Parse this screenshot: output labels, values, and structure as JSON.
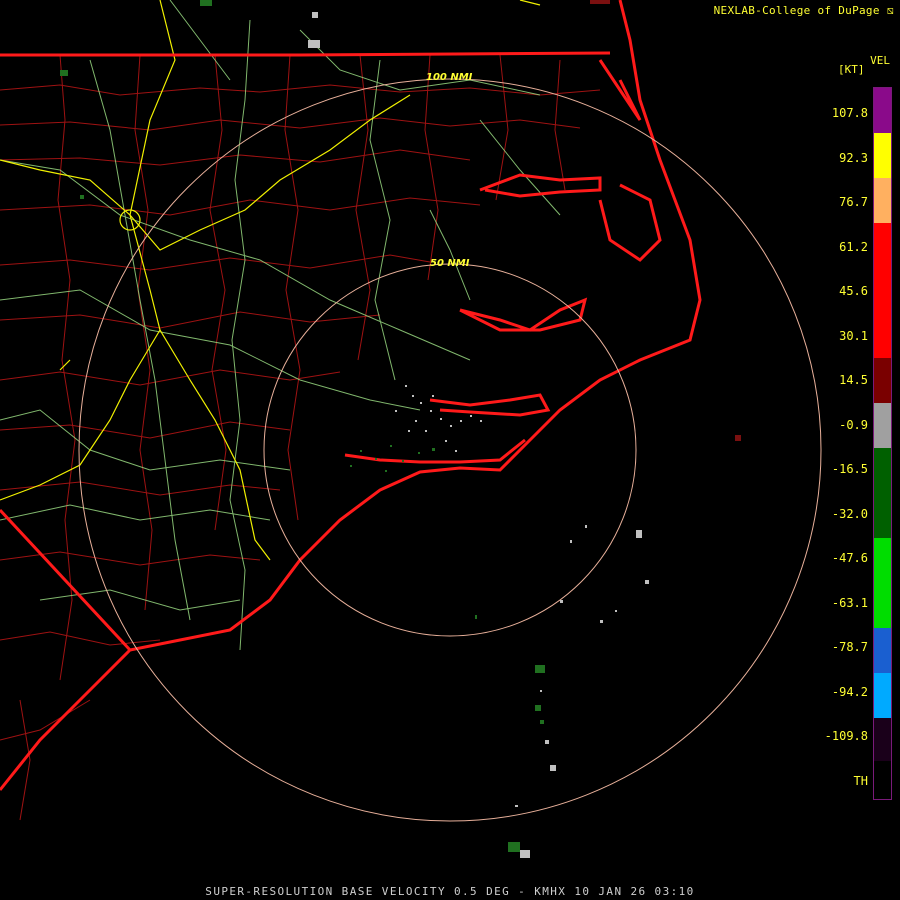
{
  "header": {
    "credit": "NEXLAB-College of DuPage ⧅"
  },
  "legend": {
    "product": "VEL",
    "unit": "[KT]",
    "ticks": [
      "107.8",
      "92.3",
      "76.7",
      "61.2",
      "45.6",
      "30.1",
      "14.5",
      "-0.9",
      "-16.5",
      "-32.0",
      "-47.6",
      "-63.1",
      "-78.7",
      "-94.2",
      "-109.8",
      "TH"
    ],
    "colors": {
      "purple": "#8a0a8a",
      "yellow": "#ffff00",
      "orange": "#ffb060",
      "red": "#ff0000",
      "dark_red": "#7a0000",
      "gray": "#a0a0a0",
      "dark_green": "#006000",
      "green": "#00dd00",
      "blue": "#1a5fd0",
      "cyan": "#00aaff",
      "th": "#1a001a"
    }
  },
  "range_rings": {
    "ring_50": "50 NMI",
    "ring_100": "100 NMI"
  },
  "footer": {
    "caption": "SUPER-RESOLUTION BASE VELOCITY 0.5 DEG - KMHX 10 JAN 26 03:10"
  },
  "map_colors": {
    "coast": "#ff1a1a",
    "county": "#c41818",
    "highway": "#aadf90",
    "interstate": "#f0f000",
    "ring": "#f0b8a0"
  }
}
